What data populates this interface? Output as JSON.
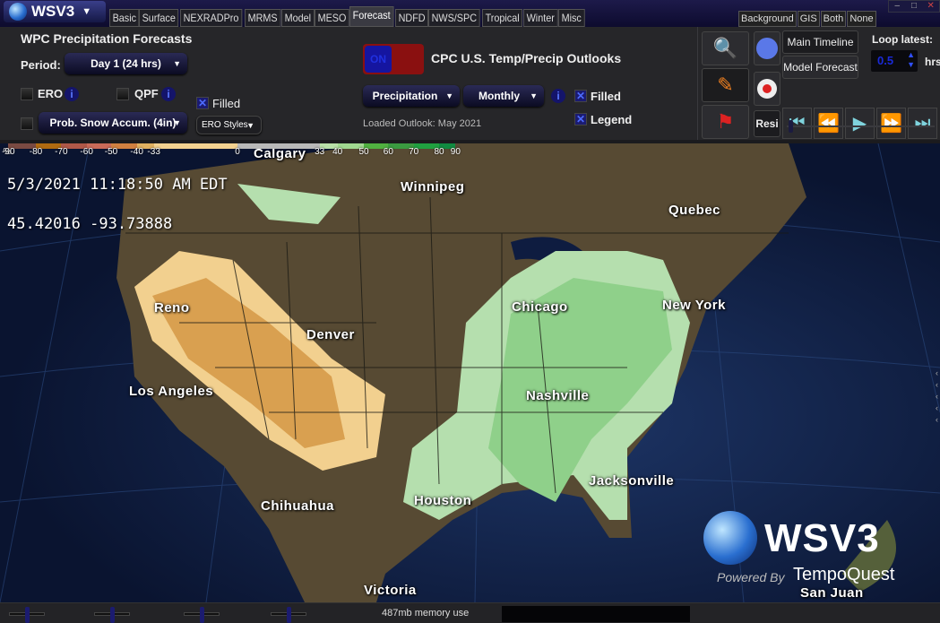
{
  "app": {
    "name": "WSV3"
  },
  "tabs": [
    "Basic",
    "Surface",
    "NEXRADPro",
    "MRMS",
    "Model",
    "MESO",
    "Forecast",
    "NDFD",
    "NWS/SPC",
    "Tropical",
    "Winter",
    "Misc"
  ],
  "active_tab": "Forecast",
  "layer_tabs": [
    "Background",
    "GIS",
    "Both",
    "None"
  ],
  "wpc": {
    "title": "WPC Precipitation Forecasts",
    "period_label": "Period:",
    "period_value": "Day 1 (24 hrs)",
    "ero_label": "ERO",
    "qpf_label": "QPF",
    "filled_label": "Filled",
    "filled_checked": true,
    "snow_value": "Prob. Snow Accum. (4in)",
    "ero_styles_label": "ERO Styles"
  },
  "cpc": {
    "toggle_label": "ON",
    "title": "CPC U.S. Temp/Precip Outlooks",
    "variable_value": "Precipitation",
    "period_value": "Monthly",
    "filled_label": "Filled",
    "legend_label": "Legend",
    "filled_checked": true,
    "legend_checked": true,
    "loaded_text": "Loaded Outlook: May 2021"
  },
  "timeline": {
    "main_timeline": "Main Timeline",
    "model_forecast": "Model Forecast",
    "loop_latest_label": "Loop latest:",
    "loop_value": "0.5",
    "loop_unit": "hrs",
    "resize_label": "Resi"
  },
  "legend": {
    "unit": "%",
    "ticks": [
      "-90",
      "-80",
      "-70",
      "-60",
      "-50",
      "-40",
      "-33",
      "0",
      "33",
      "40",
      "50",
      "60",
      "70",
      "80",
      "90"
    ]
  },
  "readout": {
    "datetime": "5/3/2021  11:18:50 AM EDT",
    "coords": "45.42016  -93.73888"
  },
  "cities": [
    "Calgary",
    "Winnipeg",
    "Quebec",
    "Reno",
    "Denver",
    "Chicago",
    "New York",
    "Los Angeles",
    "Nashville",
    "Houston",
    "Jacksonville",
    "Chihuahua",
    "Victoria",
    "San Juan"
  ],
  "watermark": {
    "name": "WSV3",
    "powered": "Powered By",
    "company": "TempoQuest"
  },
  "status": {
    "memory": "487mb memory use"
  },
  "colors": {
    "below": "#f2d08f",
    "below_strong": "#d9a050",
    "above": "#b5dfae",
    "above_strong": "#8fd08a"
  }
}
